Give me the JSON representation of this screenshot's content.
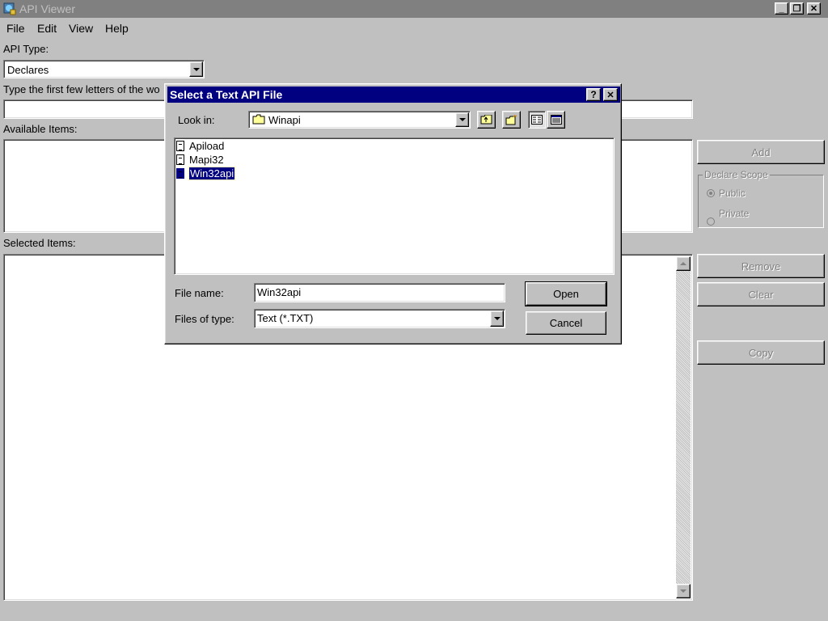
{
  "window": {
    "title": "API Viewer",
    "minimize": "_",
    "restore": "❐",
    "close": "✕"
  },
  "menu": [
    {
      "label": "File"
    },
    {
      "label": "Edit"
    },
    {
      "label": "View"
    },
    {
      "label": "Help"
    }
  ],
  "api_type": {
    "label": "API Type:",
    "value": "Declares"
  },
  "search": {
    "label": "Type the first few letters of the wo",
    "value": ""
  },
  "available": {
    "label": "Available Items:"
  },
  "selected": {
    "label": "Selected Items:"
  },
  "buttons": {
    "add": "Add",
    "remove": "Remove",
    "clear": "Clear",
    "copy": "Copy"
  },
  "scope": {
    "label": "Declare Scope",
    "public": "Public",
    "private": "Private"
  },
  "dialog": {
    "title": "Select a Text API File",
    "help": "?",
    "close": "✕",
    "look_in_label": "Look in:",
    "look_in_value": "Winapi",
    "files": [
      "Apiload",
      "Mapi32",
      "Win32api"
    ],
    "filename_label": "File name:",
    "filename_value": "Win32api",
    "filetype_label": "Files of type:",
    "filetype_value": "Text (*.TXT)",
    "open": "Open",
    "cancel": "Cancel"
  }
}
